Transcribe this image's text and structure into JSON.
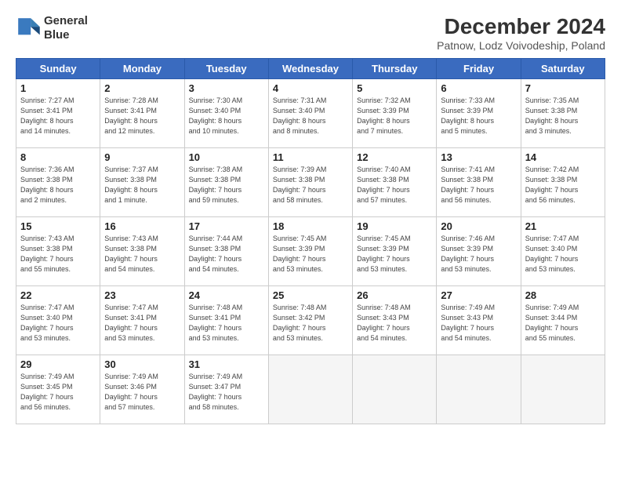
{
  "header": {
    "logo_line1": "General",
    "logo_line2": "Blue",
    "title": "December 2024",
    "subtitle": "Patnow, Lodz Voivodeship, Poland"
  },
  "days_of_week": [
    "Sunday",
    "Monday",
    "Tuesday",
    "Wednesday",
    "Thursday",
    "Friday",
    "Saturday"
  ],
  "weeks": [
    [
      {
        "day": 1,
        "info": "Sunrise: 7:27 AM\nSunset: 3:41 PM\nDaylight: 8 hours\nand 14 minutes."
      },
      {
        "day": 2,
        "info": "Sunrise: 7:28 AM\nSunset: 3:41 PM\nDaylight: 8 hours\nand 12 minutes."
      },
      {
        "day": 3,
        "info": "Sunrise: 7:30 AM\nSunset: 3:40 PM\nDaylight: 8 hours\nand 10 minutes."
      },
      {
        "day": 4,
        "info": "Sunrise: 7:31 AM\nSunset: 3:40 PM\nDaylight: 8 hours\nand 8 minutes."
      },
      {
        "day": 5,
        "info": "Sunrise: 7:32 AM\nSunset: 3:39 PM\nDaylight: 8 hours\nand 7 minutes."
      },
      {
        "day": 6,
        "info": "Sunrise: 7:33 AM\nSunset: 3:39 PM\nDaylight: 8 hours\nand 5 minutes."
      },
      {
        "day": 7,
        "info": "Sunrise: 7:35 AM\nSunset: 3:38 PM\nDaylight: 8 hours\nand 3 minutes."
      }
    ],
    [
      {
        "day": 8,
        "info": "Sunrise: 7:36 AM\nSunset: 3:38 PM\nDaylight: 8 hours\nand 2 minutes."
      },
      {
        "day": 9,
        "info": "Sunrise: 7:37 AM\nSunset: 3:38 PM\nDaylight: 8 hours\nand 1 minute."
      },
      {
        "day": 10,
        "info": "Sunrise: 7:38 AM\nSunset: 3:38 PM\nDaylight: 7 hours\nand 59 minutes."
      },
      {
        "day": 11,
        "info": "Sunrise: 7:39 AM\nSunset: 3:38 PM\nDaylight: 7 hours\nand 58 minutes."
      },
      {
        "day": 12,
        "info": "Sunrise: 7:40 AM\nSunset: 3:38 PM\nDaylight: 7 hours\nand 57 minutes."
      },
      {
        "day": 13,
        "info": "Sunrise: 7:41 AM\nSunset: 3:38 PM\nDaylight: 7 hours\nand 56 minutes."
      },
      {
        "day": 14,
        "info": "Sunrise: 7:42 AM\nSunset: 3:38 PM\nDaylight: 7 hours\nand 56 minutes."
      }
    ],
    [
      {
        "day": 15,
        "info": "Sunrise: 7:43 AM\nSunset: 3:38 PM\nDaylight: 7 hours\nand 55 minutes."
      },
      {
        "day": 16,
        "info": "Sunrise: 7:43 AM\nSunset: 3:38 PM\nDaylight: 7 hours\nand 54 minutes."
      },
      {
        "day": 17,
        "info": "Sunrise: 7:44 AM\nSunset: 3:38 PM\nDaylight: 7 hours\nand 54 minutes."
      },
      {
        "day": 18,
        "info": "Sunrise: 7:45 AM\nSunset: 3:39 PM\nDaylight: 7 hours\nand 53 minutes."
      },
      {
        "day": 19,
        "info": "Sunrise: 7:45 AM\nSunset: 3:39 PM\nDaylight: 7 hours\nand 53 minutes."
      },
      {
        "day": 20,
        "info": "Sunrise: 7:46 AM\nSunset: 3:39 PM\nDaylight: 7 hours\nand 53 minutes."
      },
      {
        "day": 21,
        "info": "Sunrise: 7:47 AM\nSunset: 3:40 PM\nDaylight: 7 hours\nand 53 minutes."
      }
    ],
    [
      {
        "day": 22,
        "info": "Sunrise: 7:47 AM\nSunset: 3:40 PM\nDaylight: 7 hours\nand 53 minutes."
      },
      {
        "day": 23,
        "info": "Sunrise: 7:47 AM\nSunset: 3:41 PM\nDaylight: 7 hours\nand 53 minutes."
      },
      {
        "day": 24,
        "info": "Sunrise: 7:48 AM\nSunset: 3:41 PM\nDaylight: 7 hours\nand 53 minutes."
      },
      {
        "day": 25,
        "info": "Sunrise: 7:48 AM\nSunset: 3:42 PM\nDaylight: 7 hours\nand 53 minutes."
      },
      {
        "day": 26,
        "info": "Sunrise: 7:48 AM\nSunset: 3:43 PM\nDaylight: 7 hours\nand 54 minutes."
      },
      {
        "day": 27,
        "info": "Sunrise: 7:49 AM\nSunset: 3:43 PM\nDaylight: 7 hours\nand 54 minutes."
      },
      {
        "day": 28,
        "info": "Sunrise: 7:49 AM\nSunset: 3:44 PM\nDaylight: 7 hours\nand 55 minutes."
      }
    ],
    [
      {
        "day": 29,
        "info": "Sunrise: 7:49 AM\nSunset: 3:45 PM\nDaylight: 7 hours\nand 56 minutes."
      },
      {
        "day": 30,
        "info": "Sunrise: 7:49 AM\nSunset: 3:46 PM\nDaylight: 7 hours\nand 57 minutes."
      },
      {
        "day": 31,
        "info": "Sunrise: 7:49 AM\nSunset: 3:47 PM\nDaylight: 7 hours\nand 58 minutes."
      },
      {
        "day": null,
        "info": ""
      },
      {
        "day": null,
        "info": ""
      },
      {
        "day": null,
        "info": ""
      },
      {
        "day": null,
        "info": ""
      }
    ]
  ]
}
